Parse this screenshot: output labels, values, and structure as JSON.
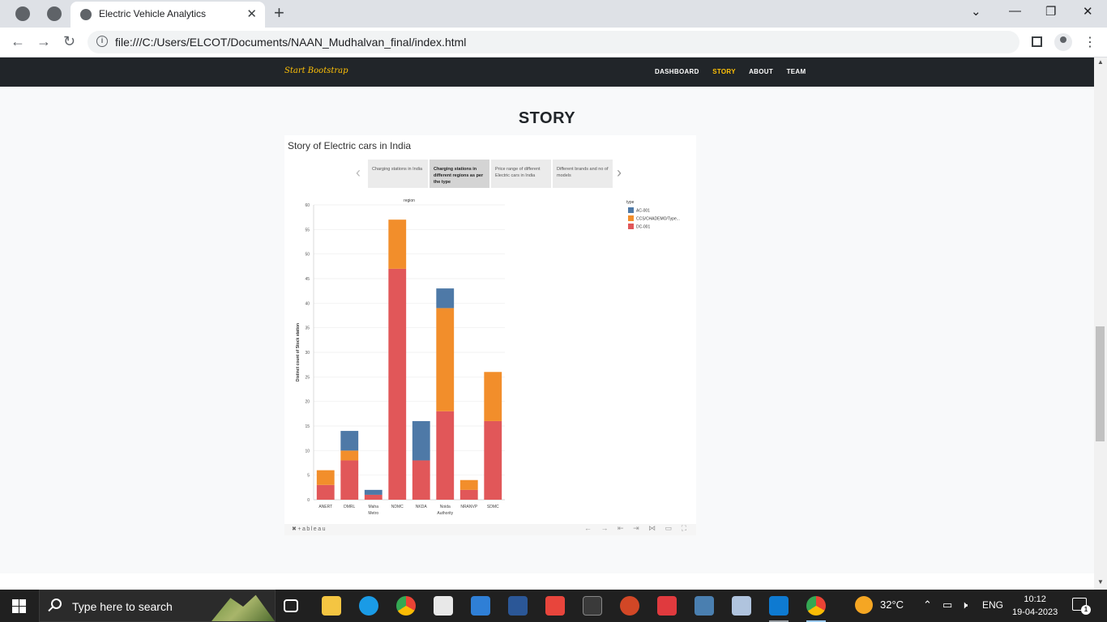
{
  "browser": {
    "tab_title": "Electric Vehicle Analytics",
    "url": "file:///C:/Users/ELCOT/Documents/NAAN_Mudhalvan_final/index.html"
  },
  "site": {
    "brand": "Start Bootstrap",
    "nav": [
      "DASHBOARD",
      "STORY",
      "ABOUT",
      "TEAM"
    ],
    "active_nav": "STORY",
    "heading": "STORY"
  },
  "tableau": {
    "story_title": "Story of Electric cars in India",
    "story_points": [
      "Charging stations in India",
      "Charging stations in different regions as per the type",
      "Price range of different Electric cars in India",
      "Different brands and no of models"
    ],
    "active_story_point": 1,
    "footer_logo": "✖+ableau"
  },
  "chart_data": {
    "type": "bar",
    "stacked": true,
    "title": "region",
    "ylabel": "Distinct count of Stock station",
    "xlabel": "",
    "ylim": [
      0,
      60
    ],
    "yticks": [
      0,
      5,
      10,
      15,
      20,
      25,
      30,
      35,
      40,
      45,
      50,
      55,
      60
    ],
    "categories": [
      "ANERT",
      "DMRL",
      "Maha Metro",
      "NDMC",
      "NKDA",
      "Noida Authority",
      "NRANVP",
      "SDMC"
    ],
    "legend_title": "type",
    "legend_position": "top-right",
    "series": [
      {
        "name": "DC-001",
        "color": "#e15759",
        "values": [
          3,
          8,
          1,
          47,
          8,
          18,
          2,
          16
        ]
      },
      {
        "name": "CCS/CHADEMO/Type...",
        "color": "#f28e2b",
        "values": [
          3,
          2,
          0,
          10,
          0,
          21,
          2,
          10
        ]
      },
      {
        "name": "AC-001",
        "color": "#4e79a7",
        "values": [
          0,
          4,
          1,
          0,
          8,
          4,
          0,
          0
        ]
      }
    ],
    "legend_order": [
      "AC-001",
      "CCS/CHADEMO/Type...",
      "DC-001"
    ],
    "grid": true
  },
  "taskbar": {
    "search_placeholder": "Type here to search",
    "weather": "32°C",
    "language": "ENG",
    "time": "10:12",
    "date": "19-04-2023",
    "notifications": "1"
  }
}
